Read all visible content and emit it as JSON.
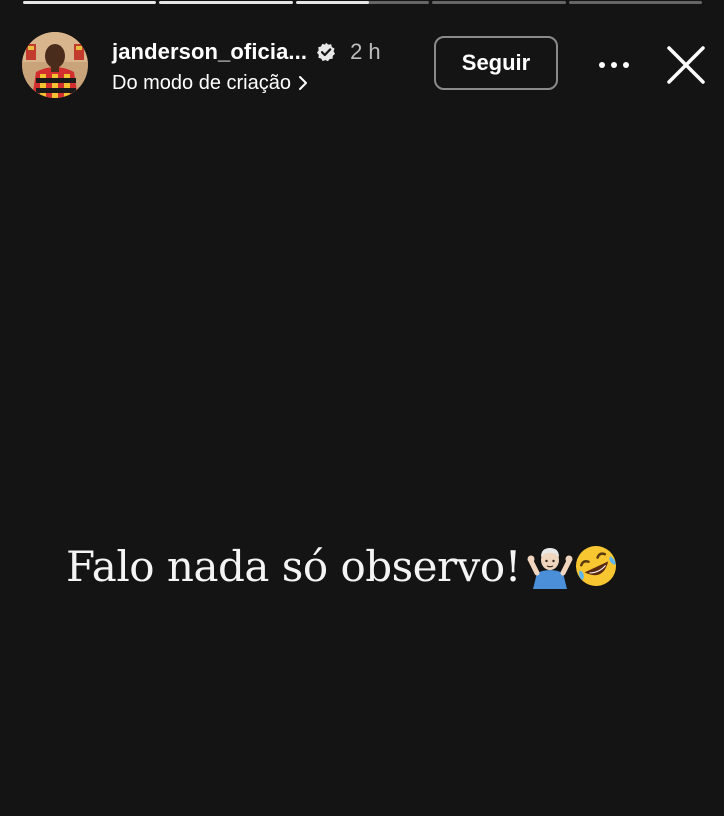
{
  "progress": {
    "segments": [
      1,
      1,
      0.55,
      0,
      0
    ]
  },
  "header": {
    "username": "janderson_oficia...",
    "timestamp": "2 h",
    "subtitle": "Do modo de criação",
    "follow_label": "Seguir",
    "more_icon": "more-horizontal-icon",
    "close_icon": "close-icon",
    "verified_icon": "verified-badge-icon"
  },
  "story": {
    "caption": "Falo nada só observo!",
    "emojis": [
      "person-shrugging-emoji",
      "rolling-on-floor-laughing-emoji"
    ]
  },
  "colors": {
    "background": "#141414",
    "text": "#ffffff",
    "muted": "#bdbdbd",
    "button_border": "#8a8a8a"
  }
}
